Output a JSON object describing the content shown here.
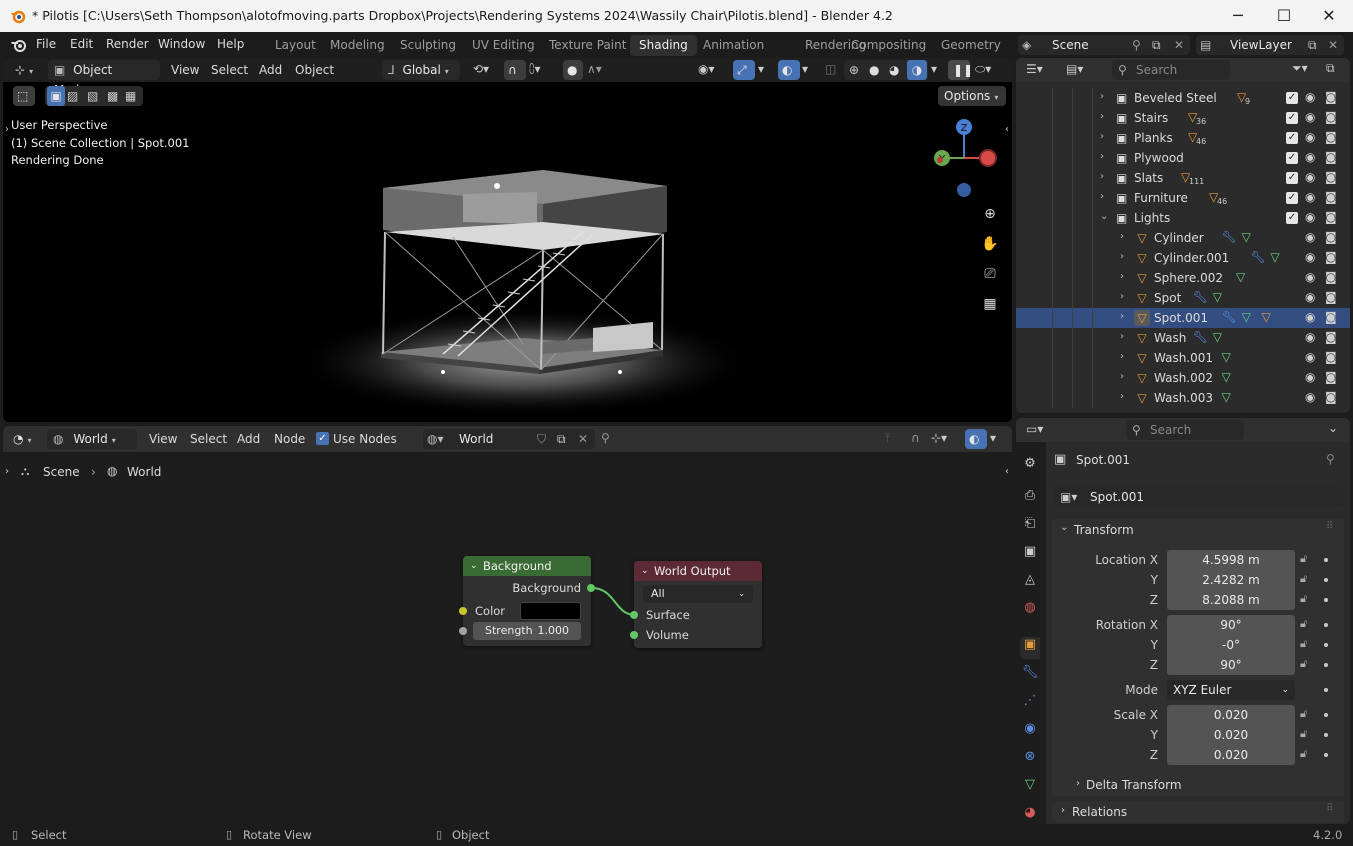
{
  "window": {
    "title": "* Pilotis [C:\\Users\\Seth Thompson\\alotofmoving.parts Dropbox\\Projects\\Rendering Systems 2024\\Wassily Chair\\Pilotis.blend] - Blender 4.2",
    "minimize": "─",
    "maximize": "☐",
    "close": "✕"
  },
  "menu": {
    "items": [
      "File",
      "Edit",
      "Render",
      "Window",
      "Help"
    ],
    "workspaces": [
      "Layout",
      "Modeling",
      "Sculpting",
      "UV Editing",
      "Texture Paint",
      "Shading",
      "Animation",
      "Rendering",
      "Compositing",
      "Geometry Nc"
    ],
    "active_workspace": "Shading",
    "scene": "Scene",
    "view_layer": "ViewLayer"
  },
  "viewport": {
    "mode": "Object Mode",
    "menus": [
      "View",
      "Select",
      "Add",
      "Object"
    ],
    "orientation": "Global",
    "options": "Options",
    "overlay_lines": [
      "User Perspective",
      "(1) Scene Collection | Spot.001",
      "Rendering Done"
    ],
    "gizmo": {
      "z": "Z",
      "y": "Y"
    }
  },
  "outliner": {
    "search_placeholder": "Search",
    "rows": [
      {
        "name": "Beveled Steel",
        "badge": "9",
        "kind": "collection"
      },
      {
        "name": "Stairs",
        "badge": "36",
        "kind": "collection"
      },
      {
        "name": "Planks",
        "badge": "46",
        "kind": "collection"
      },
      {
        "name": "Plywood",
        "badge": "",
        "kind": "collection"
      },
      {
        "name": "Slats",
        "badge": "111",
        "kind": "collection"
      },
      {
        "name": "Furniture",
        "badge": "46",
        "kind": "collection"
      },
      {
        "name": "Lights",
        "badge": "",
        "kind": "collection-open"
      },
      {
        "name": "Cylinder",
        "badge": "",
        "kind": "light"
      },
      {
        "name": "Cylinder.001",
        "badge": "",
        "kind": "light"
      },
      {
        "name": "Sphere.002",
        "badge": "",
        "kind": "light"
      },
      {
        "name": "Spot",
        "badge": "",
        "kind": "light"
      },
      {
        "name": "Spot.001",
        "badge": "",
        "kind": "light-selected"
      },
      {
        "name": "Wash",
        "badge": "",
        "kind": "light"
      },
      {
        "name": "Wash.001",
        "badge": "",
        "kind": "light"
      },
      {
        "name": "Wash.002",
        "badge": "",
        "kind": "light"
      },
      {
        "name": "Wash.003",
        "badge": "",
        "kind": "light"
      }
    ]
  },
  "node_editor": {
    "type": "World",
    "menus": [
      "View",
      "Select",
      "Add",
      "Node"
    ],
    "use_nodes_label": "Use Nodes",
    "datablock": "World",
    "breadcrumb": [
      "Scene",
      "World"
    ],
    "background_node": {
      "title": "Background",
      "output": "Background",
      "color_label": "Color",
      "strength_label": "Strength",
      "strength_value": "1.000"
    },
    "output_node": {
      "title": "World Output",
      "target": "All",
      "inputs": [
        "Surface",
        "Volume"
      ]
    }
  },
  "properties": {
    "search_placeholder": "Search",
    "object_name": "Spot.001",
    "datablock": "Spot.001",
    "transform_label": "Transform",
    "location": {
      "label": "Location X",
      "x": "4.5998 m",
      "y": "2.4282 m",
      "z": "8.2088 m"
    },
    "rotation": {
      "label": "Rotation X",
      "x": "90°",
      "y": "-0°",
      "z": "90°"
    },
    "mode": {
      "label": "Mode",
      "value": "XYZ Euler"
    },
    "scale": {
      "label": "Scale X",
      "x": "0.020",
      "y": "0.020",
      "z": "0.020"
    },
    "axis_y": "Y",
    "axis_z": "Z",
    "delta_transform": "Delta Transform",
    "relations": "Relations"
  },
  "status": {
    "select": "Select",
    "rotate": "Rotate View",
    "object": "Object",
    "version": "4.2.0"
  },
  "colors": {
    "accent": "#4772b3",
    "bg_node_header": "#3b6b34",
    "output_node_header": "#5b2a35",
    "light_icon": "#e59b3c"
  }
}
